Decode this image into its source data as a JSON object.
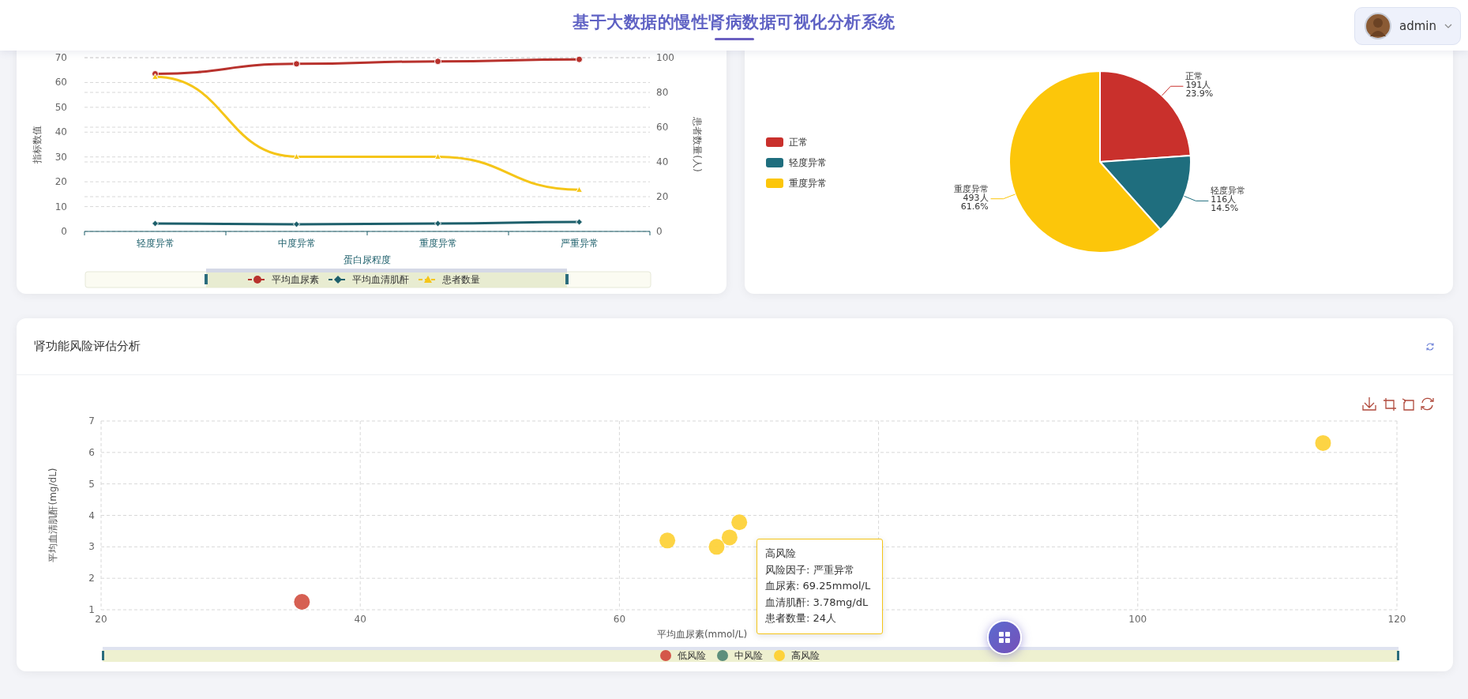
{
  "header": {
    "title": "基于大数据的慢性肾病数据可视化分析系统",
    "user": {
      "name": "admin"
    }
  },
  "protein_chart": {
    "chart_data": {
      "type": "line",
      "xlabel": "蛋白尿程度",
      "ylabel": "指标数值",
      "y2label": "患者数量(人)",
      "categories": [
        "轻度异常",
        "中度异常",
        "重度异常",
        "严重异常"
      ],
      "ylim": [
        0,
        70
      ],
      "yticks": [
        0,
        10,
        20,
        30,
        40,
        50,
        60,
        70
      ],
      "y2lim": [
        0,
        100
      ],
      "y2ticks": [
        0,
        20,
        40,
        60,
        80,
        100
      ],
      "grid": true,
      "legend": "bottom",
      "series": [
        {
          "name": "平均血尿素",
          "color": "#b8322d",
          "marker": "circle",
          "values": [
            63.5,
            67.5,
            68.5,
            69.3
          ]
        },
        {
          "name": "平均血清肌酐",
          "color": "#1d5f6b",
          "marker": "diamond",
          "values": [
            3.2,
            2.9,
            3.2,
            3.8
          ]
        },
        {
          "name": "患者数量",
          "color": "#f5c518",
          "marker": "triangle",
          "axis": "y2",
          "values": [
            89,
            43,
            43,
            24
          ]
        }
      ]
    }
  },
  "distribution_chart": {
    "chart_data": {
      "type": "pie",
      "legend": "left",
      "categories": [
        "正常",
        "轻度异常",
        "重度异常"
      ],
      "values": [
        23.9,
        14.5,
        61.6
      ],
      "colors": [
        "#c9302c",
        "#1f6e7e",
        "#fcc60a"
      ],
      "value_labels": [
        [
          "191人",
          "23.9%"
        ],
        [
          "116人",
          "14.5%"
        ],
        [
          "493人",
          "61.6%"
        ]
      ]
    }
  },
  "risk_card": {
    "title": "肾功能风险评估分析",
    "chart_data": {
      "type": "scatter",
      "xlabel": "平均血尿素(mmol/L)",
      "ylabel": "平均血清肌酐(mg/dL)",
      "xlim": [
        20,
        120
      ],
      "ylim": [
        1,
        7
      ],
      "xticks": [
        20,
        40,
        60,
        100,
        120
      ],
      "yticks": [
        1,
        2,
        3,
        4,
        5,
        6,
        7
      ],
      "grid": true,
      "legend": "bottom",
      "series": [
        {
          "name": "低风险",
          "color": "#d4574a",
          "x": [
            35.5
          ],
          "values": [
            1.25
          ]
        },
        {
          "name": "中风险",
          "color": "#5e8f7c"
        },
        {
          "name": "高风险",
          "color": "#fdd23a",
          "x": [
            63.7,
            67.5,
            68.5,
            69.25,
            114.3
          ],
          "values": [
            3.2,
            3.0,
            3.3,
            3.78,
            6.3
          ]
        }
      ]
    },
    "tooltip": {
      "title": "高风险",
      "lines": [
        "风险因子: 严重异常",
        "血尿素: 69.25mmol/L",
        "血清肌酐: 3.78mg/dL",
        "患者数量: 24人"
      ]
    }
  }
}
